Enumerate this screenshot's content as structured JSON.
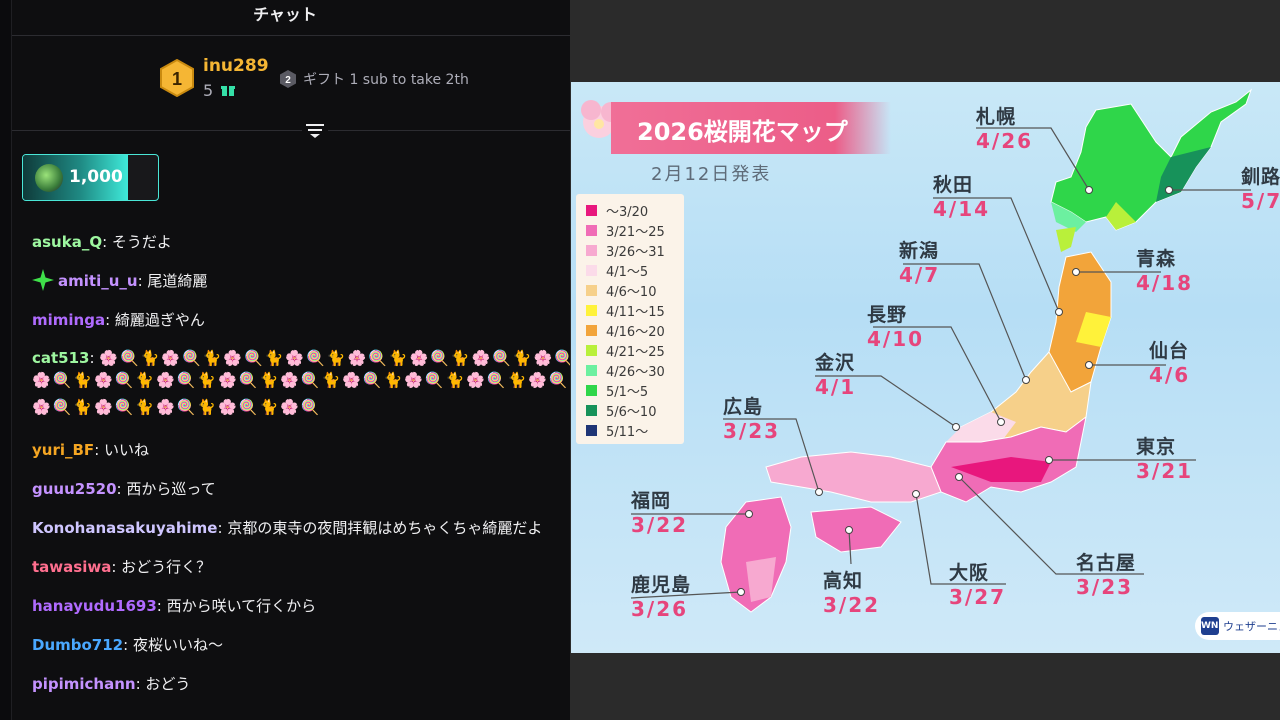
{
  "chat": {
    "title": "チャット",
    "leaderboard": {
      "rank1": {
        "rank": "1",
        "name": "inu289",
        "count": "5"
      },
      "rank2": {
        "rank": "2",
        "text": "ギフト 1 sub to take 2th"
      }
    },
    "pinned": {
      "amount": "1,000"
    },
    "messages": [
      {
        "user": "asuka_Q",
        "color": "#9ef7a0",
        "text": "そうだよ"
      },
      {
        "user": "amiti_u_u",
        "color": "#c492ff",
        "text": "尾道綺麗",
        "badge": "star-icon"
      },
      {
        "user": "miminga",
        "color": "#b06bff",
        "text": "綺麗過ぎやん"
      },
      {
        "user": "cat513",
        "color": "#9ef7a0",
        "text": ""
      },
      {
        "user": "yuri_BF",
        "color": "#f5a623",
        "text": "いいね"
      },
      {
        "user": "guuu2520",
        "color": "#c492ff",
        "text": "西から巡って"
      },
      {
        "user": "Konohanasakuyahime",
        "color": "#cfc6ff",
        "text": "京都の東寺の夜間拝観はめちゃくちゃ綺麗だよ"
      },
      {
        "user": "tawasiwa",
        "color": "#ff6f8f",
        "text": "おどう行く？"
      },
      {
        "user": "hanayudu1693",
        "color": "#b06bff",
        "text": "西から咲いて行くから"
      },
      {
        "user": "Dumbo712",
        "color": "#4aa8ff",
        "text": "夜桜いいね〜"
      },
      {
        "user": "pipimichann",
        "color": "#c492ff",
        "text": "おどう"
      }
    ],
    "emote_rows": [
      "🌸🍭🐈🌸🍭🐈🌸🍭🐈🌸🍭🐈🌸🍭🐈🌸🍭🐈🌸🍭🐈🌸🍭🐈🌸🍭",
      "🌸🍭🐈🌸🍭🐈🌸🍭🐈🌸🍭🐈🌸🍭🐈🌸🍭🐈🌸🍭🐈🌸🍭🐈🌸🍭🐈",
      "🌸🍭🐈🌸🍭🐈🌸🍭🐈🌸🍭🐈🌸🍭"
    ]
  },
  "map": {
    "title": "2026桜開花マップ",
    "date": "2月12日発表",
    "legend": [
      {
        "label": "〜3/20",
        "color": "#e8177d"
      },
      {
        "label": "3/21〜25",
        "color": "#f06cb6"
      },
      {
        "label": "3/26〜31",
        "color": "#f7a9d0"
      },
      {
        "label": "4/1〜5",
        "color": "#fbdbe9"
      },
      {
        "label": "4/6〜10",
        "color": "#f6d08a"
      },
      {
        "label": "4/11〜15",
        "color": "#fff23a"
      },
      {
        "label": "4/16〜20",
        "color": "#f2a43a"
      },
      {
        "label": "4/21〜25",
        "color": "#b9f03a"
      },
      {
        "label": "4/26〜30",
        "color": "#6cf0a0"
      },
      {
        "label": "5/1〜5",
        "color": "#2fd64a"
      },
      {
        "label": "5/6〜10",
        "color": "#17925a"
      },
      {
        "label": "5/11〜",
        "color": "#1f3576"
      }
    ],
    "cities": [
      {
        "name": "札幌",
        "date": "4/26"
      },
      {
        "name": "釧路",
        "date": "5/7"
      },
      {
        "name": "秋田",
        "date": "4/14"
      },
      {
        "name": "青森",
        "date": "4/18"
      },
      {
        "name": "新潟",
        "date": "4/7"
      },
      {
        "name": "長野",
        "date": "4/10"
      },
      {
        "name": "仙台",
        "date": "4/6"
      },
      {
        "name": "金沢",
        "date": "4/1"
      },
      {
        "name": "広島",
        "date": "3/23"
      },
      {
        "name": "東京",
        "date": "3/21"
      },
      {
        "name": "福岡",
        "date": "3/22"
      },
      {
        "name": "名古屋",
        "date": "3/23"
      },
      {
        "name": "大阪",
        "date": "3/27"
      },
      {
        "name": "高知",
        "date": "3/22"
      },
      {
        "name": "鹿児島",
        "date": "3/26"
      }
    ],
    "logo_text": "ウェザーニュ"
  }
}
